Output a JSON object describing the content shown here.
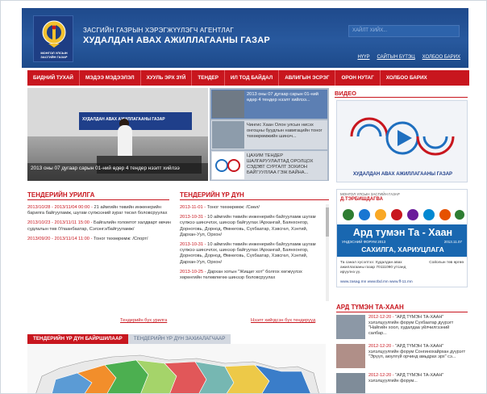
{
  "header": {
    "logo_text": "МОНГОЛ УЛСЫН ЗАСГИЙН ГАЗАР",
    "agency_sub": "ЗАСГИЙН ГАЗРЫН ХЭРЭГЖҮҮЛЭГЧ АГЕНТЛАГ",
    "agency_title": "ХУДАЛДАН АВАХ АЖИЛЛАГААНЫ ГАЗАР",
    "search_placeholder": "ХАЙЛТ ХИЙХ...",
    "links": [
      "НҮҮР",
      "САЙТЫН БҮТЭЦ",
      "ХОЛБОО БАРИХ"
    ]
  },
  "nav": [
    "БИДНИЙ ТУХАЙ",
    "МЭДЭЭ МЭДЭЭЛЭЛ",
    "ХУУЛЬ ЭРХ ЗҮЙ",
    "ТЕНДЕР",
    "ИЛ ТОД БАЙДАЛ",
    "АВЛИГЫН ЭСРЭГ",
    "ОРОН НУТАГ",
    "ХОЛБОО БАРИХ"
  ],
  "hero": {
    "caption": "2013 оны 07 дугаар сарын 01-ний өдөр 4 тендер нээлт хийлээ",
    "banner_text": "ХУДАЛДАН АВАХ АЖИЛЛАГААНЫ ГАЗАР"
  },
  "thumbs": [
    "2013 оны 07 дугаар сарын 01-ний өдөр 4 тендер нээлт хийлээ...",
    "Чингис Хаан Олон улсын нисэх онгоцны буудлын навигацийн тоног төхөөрөмжийн шинэч...",
    "ЦАХИМ ТЕНДЕР ШАЛГАРУУЛАЛТАД ОРОЛЦОХ СЭДЭВТ СУРГАЛТ ЗОХИОН БАЙГУУЛЛАА ГЭЖ БАЙНА..."
  ],
  "video": {
    "heading": "ВИДЕО",
    "title": "ХУДАЛДАН АВАХ АЖИЛЛАГААНЫ ГАЗАР"
  },
  "tender_calls": {
    "heading": "ТЕНДЕРИЙН УРИЛГА",
    "items": [
      {
        "date": "2013/10/28 - 2013/11/04 00:00 -",
        "text": "21 аймгийн төвийн инженерийн барилга байгууламж, шугам сүлжээний зураг төсөл боловсруулах"
      },
      {
        "date": "2013/10/23 - 2013/11/11 15:00 -",
        "text": "Байгалийн голомтот халдварт өвчин судлалын төв /Улаанбаатар, Сэлэнгэ/байгууламж/"
      },
      {
        "date": "2013/09/20 - 2013/11/14 11:00 -",
        "text": "Тоног төхөөрөмж: /Спорт/"
      }
    ],
    "more": "Тендерийн бүх урилга"
  },
  "tender_results": {
    "heading": "ТЕНДЕРИЙН ҮР ДҮН",
    "items": [
      {
        "date": "2013-11-01 -",
        "text": "Тоног төхөөрөмж: /Сөөл/"
      },
      {
        "date": "2013-10-31 -",
        "text": "10 аймгийн төвийн инженерийн байгууламж шугам сүлжээ шинэчлэх, шинээр байгуулах /Архангай, Баянхонгор, Дорноговь, Дорнод, Өмнөговь, Сүхбаатар, Хэвсгөл, Хэнтий, Дархан-Уул, Орхон/"
      },
      {
        "date": "2013-10-31 -",
        "text": "10 аймгийн төвийн инженерийн байгууламж шугам сүлжээ шинэчлэх, шинээр байгуулах /Архангай, Баянхонгор, Дорноговь, Дорнод, Өмнөговь, Сүхбаатар, Хэвсгөл, Хэнтий, Дархан-Уул, Орхон/"
      },
      {
        "date": "2013-10-25 -",
        "text": "Дархан хотын \"Жищиг хот\" болгох хөгжүүлэх хөрөнгийн төлөвлөгөө шинээр боловсруулах"
      }
    ],
    "more": "Нээлт хийгдсэн бүх тендерүүд"
  },
  "tabs": [
    "ТЕНДЕРИЙН ҮР ДҮН БАЙРШИЛААР",
    "ТЕНДЕРИЙН ҮР ДҮН ЗАХИАЛАГЧААР"
  ],
  "ad": {
    "tag": "МОНГОЛ УЛСЫН ЗАСГИЙН ГАЗАР",
    "who": "Д.ТЭРБИШДАГВА",
    "big": "Ард тумэн Та - Хаан",
    "small": "УНДЭСНИЙ ФОРУМ 2013",
    "date": "2013.11.07",
    "date_sub": "Сойолын төв өргөө",
    "place": "САХИЛГА, ХАРИУЦЛАГА",
    "reg": "Та санал хүсэлтээ: Худалдан авах ажиллагааны газар 70111090 утсанд ирүүлнэ үү.",
    "sites": "www.zasag.mn    www.tbd.mn    www.ff-11.mn"
  },
  "right_news": {
    "heading": "АРД ТҮМЭН ТА-ХААН",
    "items": [
      {
        "date": "2012-12-20 -",
        "text": "\"АРД ТҮМЭН ТА-ХААН\" хэлэлцүүлгийн форум Сүхбаатар дүүрэгт \"Найгийн хоол, худалдаа үйлчилгээний салбар..."
      },
      {
        "date": "2012-12-20 -",
        "text": "\"АРД ТҮМЭН ТА-ХААН\" хэлэлцүүлгийн форум Сонгинохайрхан дүүрэгт \"Эрүүл, аюулгүй орчинд амьдрах эрх\" сэ..."
      },
      {
        "date": "2012-12-20 -",
        "text": "\"АРД ТҮМЭН ТА-ХААН\" хэлэлцүүлгийн форум..."
      }
    ]
  },
  "colors": {
    "header_blue": "#1f4a8c",
    "nav_red": "#c8161e",
    "accent_red": "#c8161e"
  }
}
